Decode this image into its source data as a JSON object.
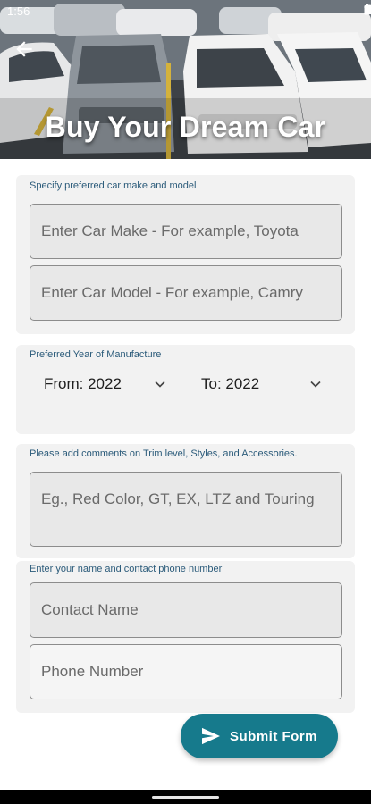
{
  "status": {
    "time": "1:56"
  },
  "header": {
    "title": "Buy Your Dream Car"
  },
  "make_model": {
    "label": "Specify preferred car make and model",
    "make_placeholder": "Enter Car Make - For example, Toyota",
    "model_placeholder": "Enter Car Model - For example, Camry"
  },
  "year": {
    "label": "Preferred Year of Manufacture",
    "from": "From: 2022",
    "to": "To: 2022"
  },
  "comments": {
    "label": "Please add comments on Trim level, Styles, and Accessories.",
    "placeholder": "Eg., Red Color, GT, EX, LTZ and Touring"
  },
  "contact": {
    "label": "Enter your name and contact phone number",
    "name_placeholder": "Contact Name",
    "phone_placeholder": "Phone Number"
  },
  "actions": {
    "submit_label": "Submit Form"
  },
  "colors": {
    "accent": "#167a8c",
    "label_text": "#2b5b7a"
  }
}
